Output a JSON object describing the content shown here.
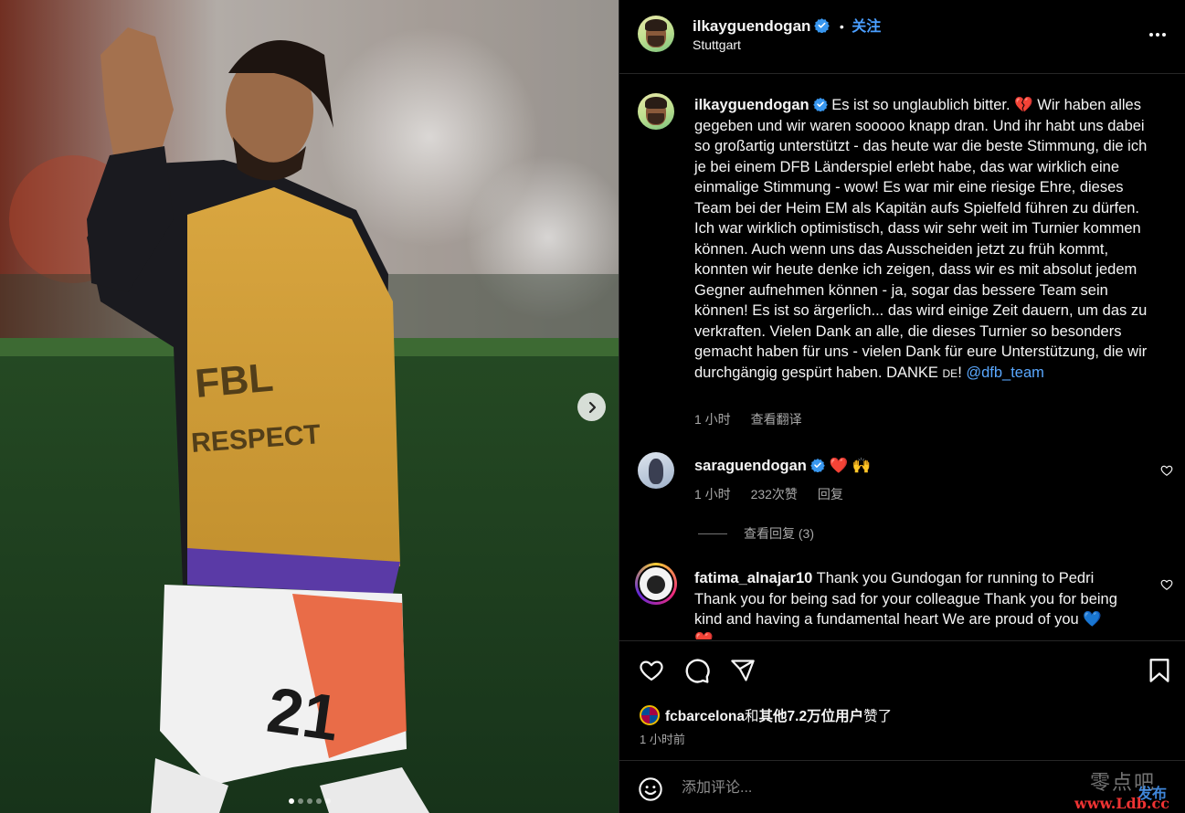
{
  "header": {
    "username": "ilkayguendogan",
    "separator": "•",
    "follow_label": "关注",
    "location": "Stuttgart",
    "more_icon": "more-horizontal-icon"
  },
  "caption": {
    "username": "ilkayguendogan",
    "text": " Es ist so unglaublich bitter. 💔 Wir haben alles gegeben und wir waren sooooo knapp dran. Und ihr habt uns dabei so großartig unterstützt - das heute war die beste Stimmung, die ich je bei einem DFB Länderspiel erlebt habe, das war wirklich eine einmalige Stimmung - wow! Es war mir eine riesige Ehre, dieses Team bei der Heim EM als Kapitän aufs Spielfeld führen zu dürfen. Ich war wirklich optimistisch, dass wir sehr weit im Turnier kommen können. Auch wenn uns das Ausscheiden jetzt zu früh kommt, konnten wir heute denke ich zeigen, dass wir es mit absolut jedem Gegner aufnehmen können - ja, sogar das bessere Team sein können! Es ist so ärgerlich... das wird einige Zeit dauern, um das zu verkraften. Vielen Dank an alle, die dieses Turnier so besonders gemacht haben für uns - vielen Dank für eure Unterstützung, die wir durchgängig gespürt haben. DANKE ",
    "flag": "DE",
    "flag_suffix": "! ",
    "mention": "@dfb_team",
    "time": "1 小时",
    "translate": "查看翻译"
  },
  "comments": [
    {
      "username": "saraguendogan",
      "text": " ❤️ 🙌",
      "time": "1 小时",
      "likes": "232次赞",
      "reply": "回复",
      "view_replies": "查看回复 (3)"
    },
    {
      "username": "fatima_alnajar10",
      "text": " Thank you Gundogan for running to Pedri Thank you for being sad for your colleague Thank you for being kind and having a fundamental heart We are proud of you 💙 ❤️"
    }
  ],
  "actions": {
    "likes_user": "fcbarcelona",
    "likes_join": "和",
    "likes_rest": "其他7.2万位用户",
    "likes_suffix": "赞了",
    "time_ago": "1 小时前"
  },
  "comment_bar": {
    "placeholder": "添加评论...",
    "post_label": "发布"
  },
  "watermark": {
    "line1": "零点吧",
    "line2": "www.Ldb.cc"
  },
  "colors": {
    "accent": "#4a9eff",
    "background": "#000000",
    "divider": "#262626",
    "secondary_text": "#a8a8a8"
  }
}
